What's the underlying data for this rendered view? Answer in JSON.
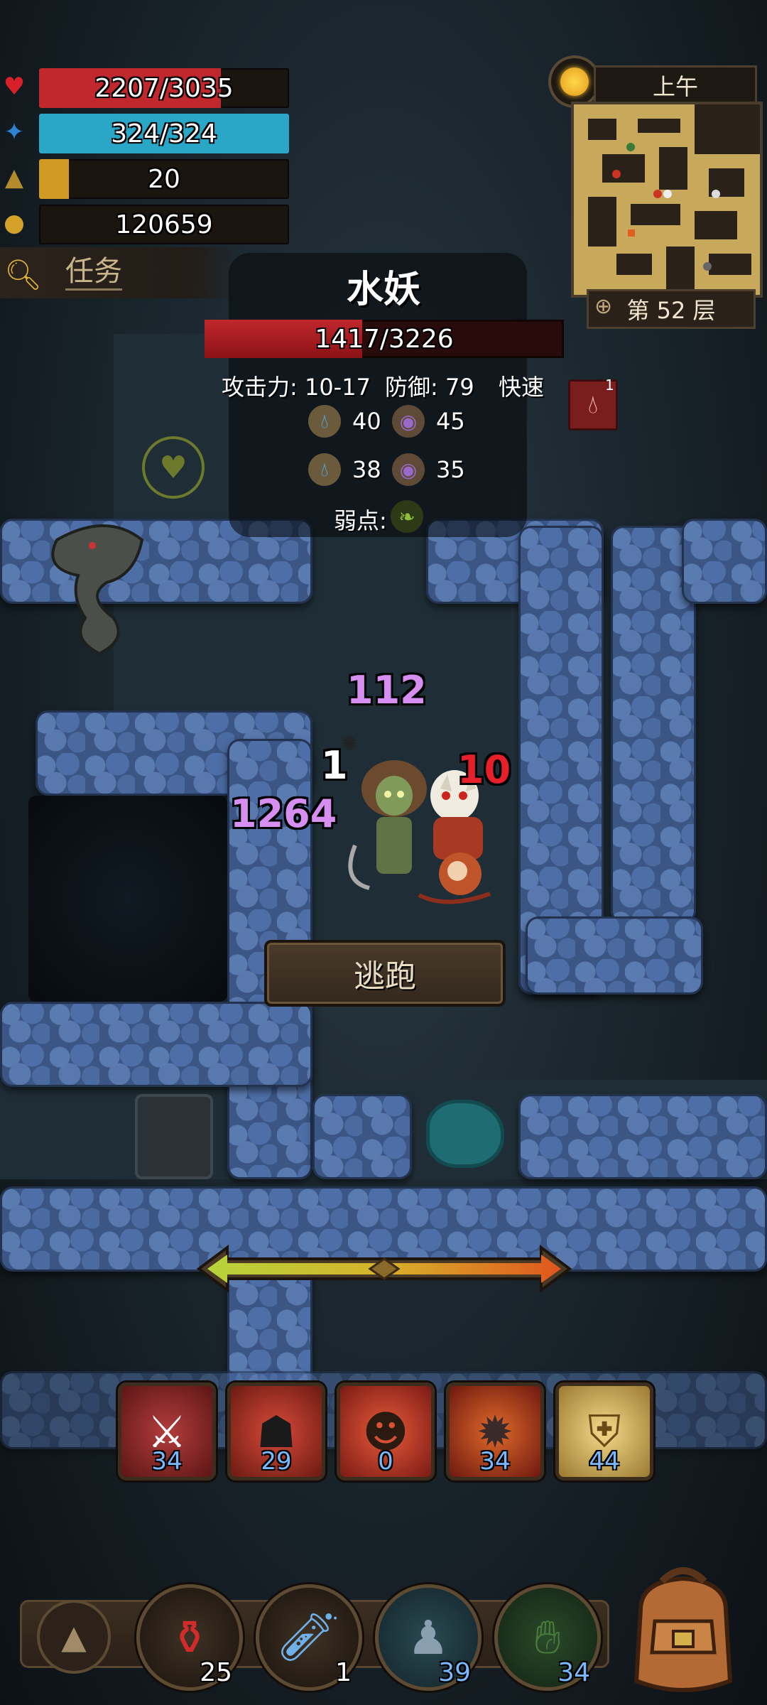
{
  "player": {
    "hp": "2207/3035",
    "hp_fraction": 0.727,
    "mp": "324/324",
    "mp_fraction": 1.0,
    "level": "20",
    "xp_fraction": 0.12,
    "gold": "120659"
  },
  "quest": {
    "label": "任务"
  },
  "minimap": {
    "time": "上午",
    "floor": "第 52 层"
  },
  "enemy": {
    "name": "水妖",
    "hp": "1417/3226",
    "hp_fraction": 0.439,
    "attack": "攻击力: 10-17",
    "defense": "防御: 79",
    "speed": "快速",
    "resist_water_atk": "40",
    "resist_dark_atk": "45",
    "resist_water_def": "38",
    "resist_dark_def": "35",
    "weakness_label": "弱点:",
    "status_count": "1"
  },
  "combat_numbers": {
    "a": "112",
    "b": "1",
    "c": "10",
    "d": "1264"
  },
  "flee_label": "逃跑",
  "skills": [
    {
      "icon": "sword-strike-icon",
      "count": "34"
    },
    {
      "icon": "shadow-warrior-icon",
      "count": "29"
    },
    {
      "icon": "slash-figure-icon",
      "count": "0"
    },
    {
      "icon": "beast-roar-icon",
      "count": "34"
    },
    {
      "icon": "holy-shield-icon",
      "count": "44"
    }
  ],
  "items": [
    {
      "icon": "red-potion-icon",
      "count": "25",
      "color": "#ffffff"
    },
    {
      "icon": "blue-vial-icon",
      "count": "1",
      "color": "#ffffff"
    },
    {
      "icon": "spirit-figure-icon",
      "count": "39",
      "color": "#7ab8ff"
    },
    {
      "icon": "green-hand-icon",
      "count": "34",
      "color": "#7ab8ff"
    }
  ],
  "colors": {
    "hp": "#c0282e",
    "mp": "#2aa7c7",
    "xp": "#d19a22",
    "damage_purple": "#d68ff0",
    "damage_red": "#e5202a"
  }
}
